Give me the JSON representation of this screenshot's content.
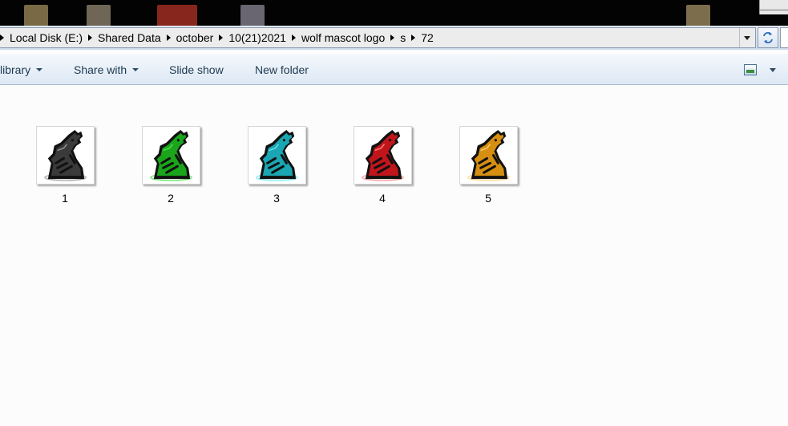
{
  "breadcrumb": {
    "items": [
      "Local Disk (E:)",
      "Shared Data",
      "october",
      "10(21)2021",
      "wolf mascot logo",
      "s",
      "72"
    ]
  },
  "toolbar": {
    "library_label": "library",
    "share_label": "Share with",
    "slideshow_label": "Slide show",
    "newfolder_label": "New folder"
  },
  "files": [
    {
      "name": "1",
      "icon": "wolf-mascot-image",
      "color": "#3a3a3a",
      "glow": "#9a9a9a"
    },
    {
      "name": "2",
      "icon": "wolf-mascot-image",
      "color": "#1aa51a",
      "glow": "#53e053"
    },
    {
      "name": "3",
      "icon": "wolf-mascot-image",
      "color": "#1aa6b2",
      "glow": "#6fe8f2"
    },
    {
      "name": "4",
      "icon": "wolf-mascot-image",
      "color": "#c0161b",
      "glow": "#ff8b8b"
    },
    {
      "name": "5",
      "icon": "wolf-mascot-image",
      "color": "#d68f10",
      "glow": "#ffd27a"
    }
  ],
  "desktop_thumbs": [
    {
      "color": "#d9c07a"
    },
    {
      "color": "#c9b89a"
    },
    {
      "color": "#c0362a"
    },
    {
      "color": "#bdb6cc"
    },
    {
      "color": "#e0c48a"
    },
    {
      "color": "#d7cfa5"
    }
  ]
}
